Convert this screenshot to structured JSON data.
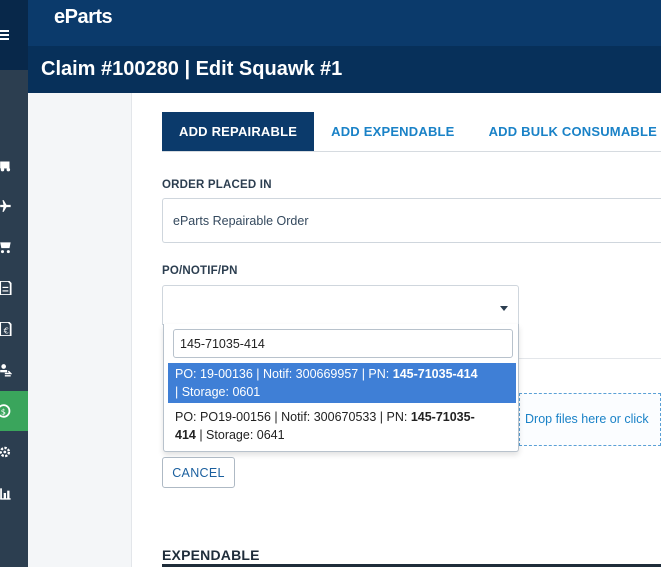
{
  "app": {
    "logo": "eParts"
  },
  "title": "Claim #100280 | Edit Squawk #1",
  "colors": {
    "brand_dark": "#07305a",
    "brand": "#0b3a6b",
    "accent_link": "#1a82c7",
    "active_nav": "#3aa55c",
    "highlight": "#3f7fd6"
  },
  "sidebar": {
    "items": [
      {
        "icon": "menu-icon"
      },
      {
        "icon": "truck-icon"
      },
      {
        "icon": "airplane-icon"
      },
      {
        "icon": "cart-icon"
      },
      {
        "icon": "document-icon"
      },
      {
        "icon": "invoice-icon"
      },
      {
        "icon": "transfer-icon"
      },
      {
        "icon": "dollar-icon",
        "active": true
      },
      {
        "icon": "gear-icon"
      },
      {
        "icon": "bar-chart-icon"
      }
    ]
  },
  "tabs": [
    {
      "label": "ADD REPAIRABLE",
      "active": true
    },
    {
      "label": "ADD EXPENDABLE"
    },
    {
      "label": "ADD BULK CONSUMABLE"
    }
  ],
  "form": {
    "order_placed_in": {
      "label": "ORDER PLACED IN",
      "value": "eParts Repairable Order"
    },
    "po_notif_pn": {
      "label": "PO/NOTIF/PN",
      "search_value": "145-71035-414"
    }
  },
  "dropdown_options": [
    {
      "line1_prefix": "PO: 19-00136 | Notif: 300669957 | PN: ",
      "pn": "145-71035-414",
      "line2": "| Storage: 0601",
      "highlighted": true
    },
    {
      "line1_prefix": "PO: PO19-00156 | Notif: 300670533 | PN: ",
      "pn": "145-71035-",
      "pn_cont": "414",
      "line2": " | Storage: 0641"
    }
  ],
  "dropzone": {
    "text": "Drop files here or click"
  },
  "buttons": {
    "cancel": "CANCEL"
  },
  "sections": {
    "expendable": "EXPENDABLE"
  }
}
